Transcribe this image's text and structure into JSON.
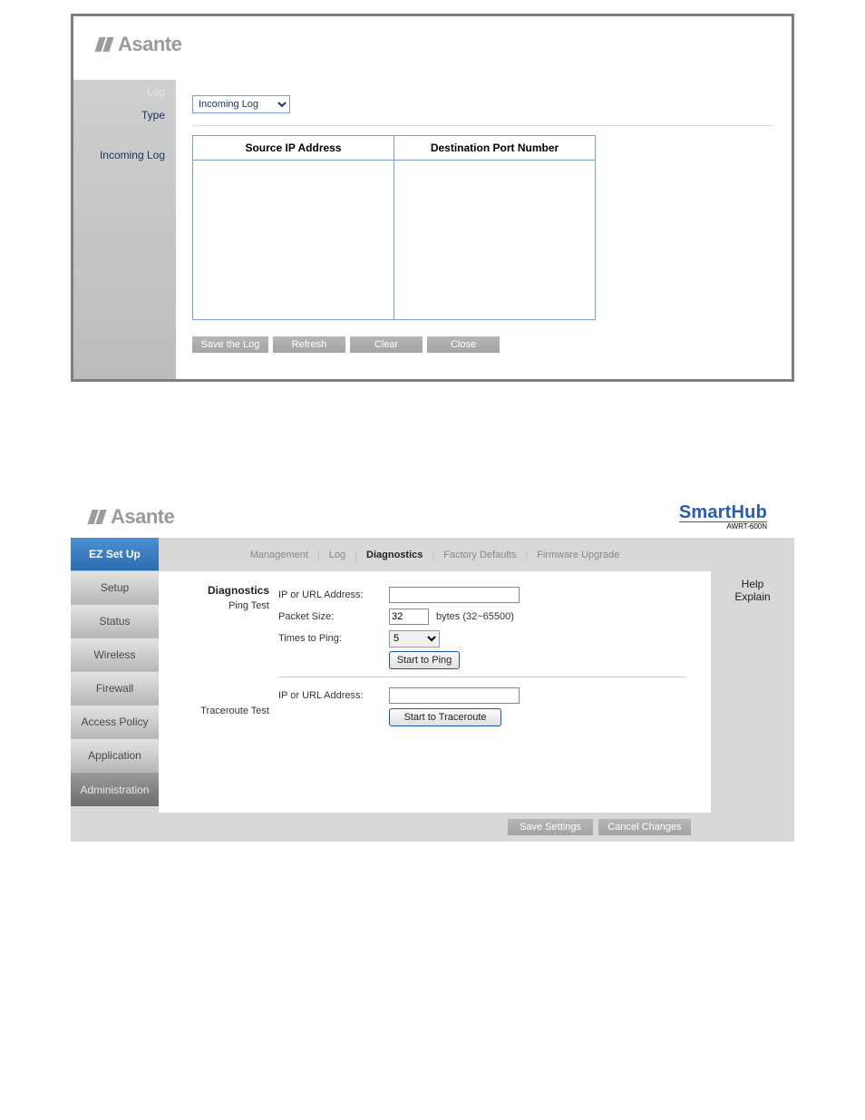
{
  "brand": {
    "name": "Asante"
  },
  "panel1": {
    "section_title": "Log",
    "type_label": "Type",
    "type_selected": "Incoming Log",
    "section_sublabel": "Incoming Log",
    "table": {
      "col1": "Source IP Address",
      "col2": "Destination Port Number"
    },
    "buttons": {
      "save": "Save the Log",
      "refresh": "Refresh",
      "clear": "Clear",
      "close": "Close"
    }
  },
  "panel2": {
    "product": {
      "name": "SmartHub",
      "model": "AWRT-600N"
    },
    "leftnav": {
      "ez": "EZ Set Up",
      "setup": "Setup",
      "status": "Status",
      "wireless": "Wireless",
      "firewall": "Firewall",
      "access": "Access Policy",
      "application": "Application",
      "admin": "Administration"
    },
    "subnav": {
      "management": "Management",
      "log": "Log",
      "diagnostics": "Diagnostics",
      "factory": "Factory Defaults",
      "firmware": "Firmware Upgrade"
    },
    "diag": {
      "heading": "Diagnostics",
      "ping_label": "Ping Test",
      "trace_label": "Traceroute Test",
      "ip_label": "IP or URL Address:",
      "packet_label": "Packet Size:",
      "packet_value": "32",
      "packet_hint": "bytes (32~65500)",
      "times_label": "Times to Ping:",
      "times_value": "5",
      "start_ping": "Start to Ping",
      "start_trace": "Start to Traceroute"
    },
    "help": {
      "line1": "Help",
      "line2": "Explain"
    },
    "footer": {
      "save": "Save Settings",
      "cancel": "Cancel Changes"
    }
  }
}
